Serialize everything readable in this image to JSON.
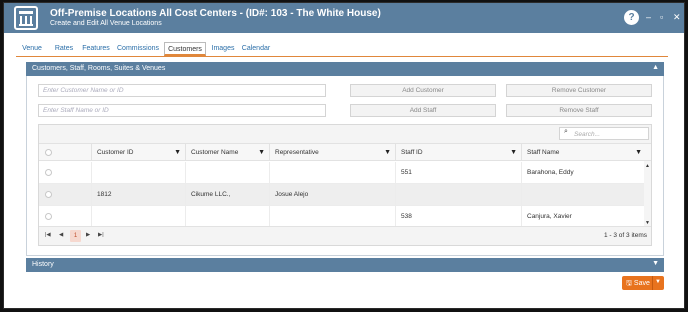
{
  "window": {
    "title": "Off-Premise Locations All Cost Centers - (ID#: 103 - The White House)",
    "subtitle": "Create and Edit All Venue Locations",
    "help_label": "?",
    "minimize_glyph": "–",
    "maximize_glyph": "▫",
    "close_glyph": "✕"
  },
  "tabs": [
    {
      "label": "Venue"
    },
    {
      "label": "Rates"
    },
    {
      "label": "Features"
    },
    {
      "label": "Commissions"
    },
    {
      "label": "Customers",
      "active": true
    },
    {
      "label": "Images"
    },
    {
      "label": "Calendar"
    }
  ],
  "section": {
    "title": "Customers, Staff, Rooms, Suites & Venues",
    "customer_input_placeholder": "Enter Customer Name or ID",
    "staff_input_placeholder": "Enter Staff Name or ID",
    "add_customer_label": "Add Customer",
    "remove_customer_label": "Remove Customer",
    "add_staff_label": "Add Staff",
    "remove_staff_label": "Remove Staff"
  },
  "grid": {
    "search_placeholder": "Search...",
    "columns": [
      "Customer ID",
      "Customer Name",
      "Representative",
      "Staff ID",
      "Staff Name"
    ],
    "rows": [
      {
        "customer_id": "",
        "customer_name": "",
        "representative": "",
        "staff_id": "551",
        "staff_name": "Barahona, Eddy"
      },
      {
        "customer_id": "1812",
        "customer_name": "Cikume LLC.,",
        "representative": "Josue Alejo",
        "staff_id": "",
        "staff_name": ""
      },
      {
        "customer_id": "",
        "customer_name": "",
        "representative": "",
        "staff_id": "538",
        "staff_name": "Canjura, Xavier"
      }
    ],
    "pager": {
      "current_page": "1",
      "info": "1 - 3 of 3 items"
    }
  },
  "history": {
    "title": "History"
  },
  "footer": {
    "save_label": "Save"
  },
  "colors": {
    "header_blue": "#5b7f9f",
    "accent_orange": "#e8731e"
  }
}
